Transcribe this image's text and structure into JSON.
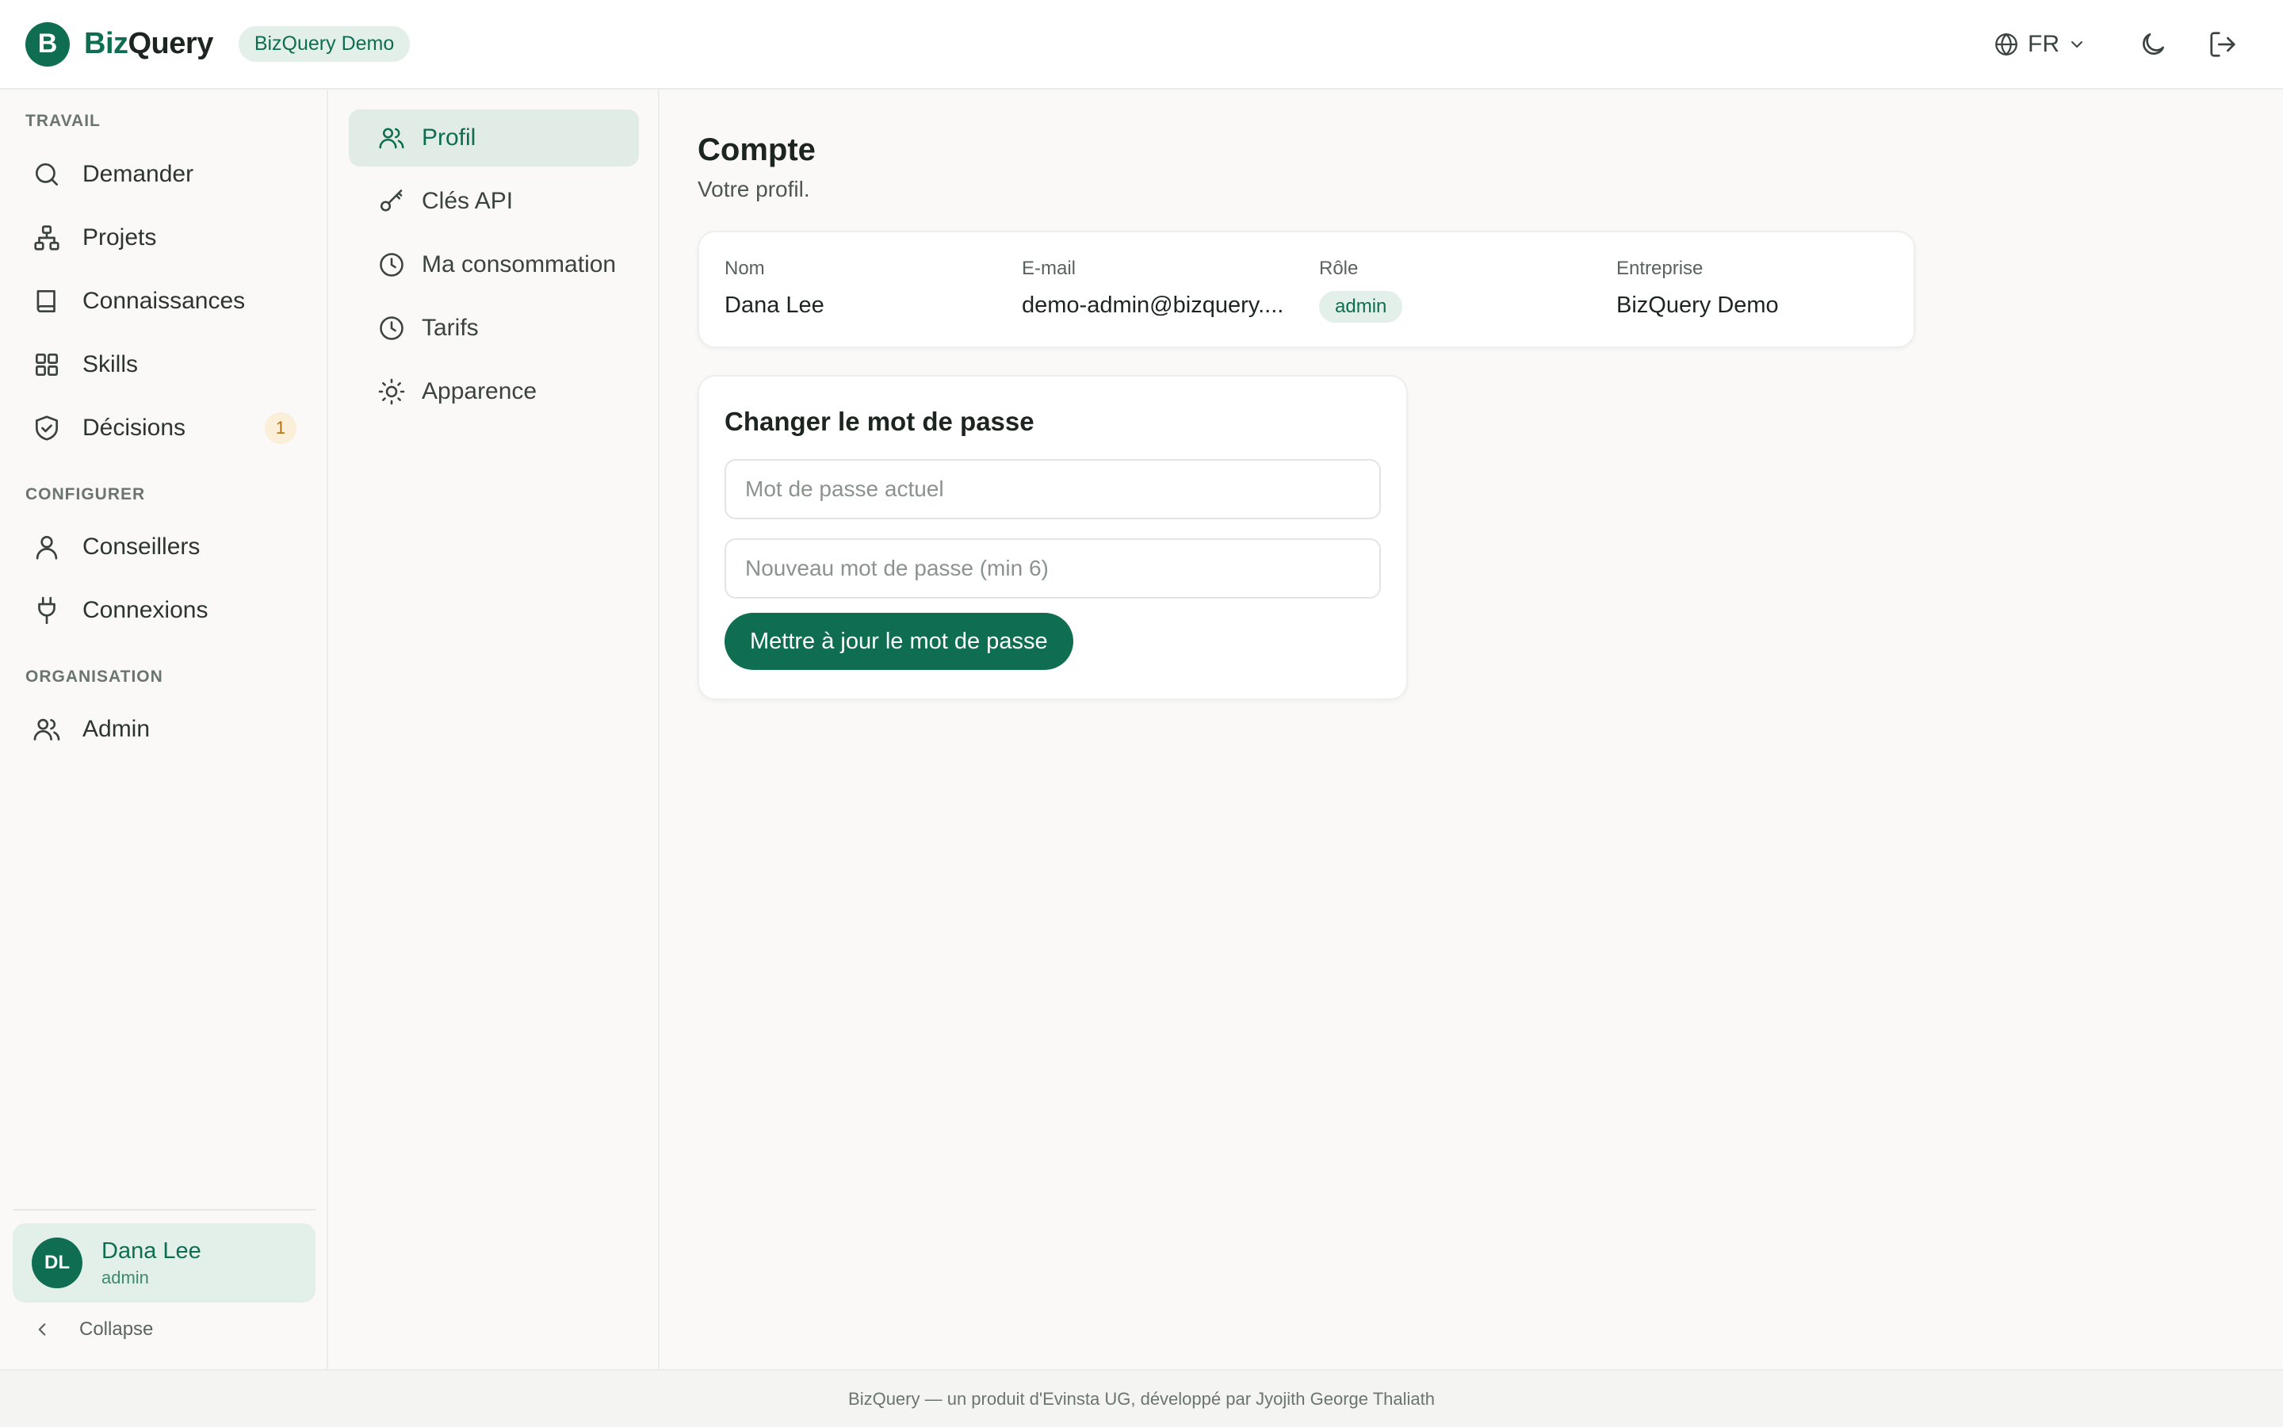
{
  "header": {
    "logo_letter": "B",
    "brand_part1": "Biz",
    "brand_part2": "Query",
    "workspace_badge": "BizQuery Demo",
    "language": "FR"
  },
  "sidebar": {
    "sections": {
      "work": "TRAVAIL",
      "configure": "CONFIGURER",
      "organisation": "ORGANISATION"
    },
    "items": {
      "ask": "Demander",
      "projects": "Projets",
      "knowledge": "Connaissances",
      "skills": "Skills",
      "decisions": "Décisions",
      "decisions_count": "1",
      "advisors": "Conseillers",
      "connections": "Connexions",
      "admin": "Admin"
    },
    "user": {
      "initials": "DL",
      "name": "Dana Lee",
      "role": "admin"
    },
    "collapse_label": "Collapse"
  },
  "subnav": {
    "profile": "Profil",
    "api_keys": "Clés API",
    "usage": "Ma consommation",
    "pricing": "Tarifs",
    "appearance": "Apparence"
  },
  "main": {
    "title": "Compte",
    "subtitle": "Votre profil.",
    "profile": {
      "name_label": "Nom",
      "name_value": "Dana Lee",
      "email_label": "E-mail",
      "email_value": "demo-admin@bizquery....",
      "role_label": "Rôle",
      "role_value": "admin",
      "company_label": "Entreprise",
      "company_value": "BizQuery Demo"
    },
    "password": {
      "title": "Changer le mot de passe",
      "current_placeholder": "Mot de passe actuel",
      "new_placeholder": "Nouveau mot de passe (min 6)",
      "submit_label": "Mettre à jour le mot de passe"
    }
  },
  "footer": {
    "text": "BizQuery — un produit d'Evinsta UG, développé par Jyojith George Thaliath"
  },
  "colors": {
    "brand": "#0f6e52",
    "brand_soft": "#e3efe9",
    "badge_warning_bg": "#fcefd9",
    "badge_warning_fg": "#b5720e",
    "surface": "#faf9f7"
  }
}
